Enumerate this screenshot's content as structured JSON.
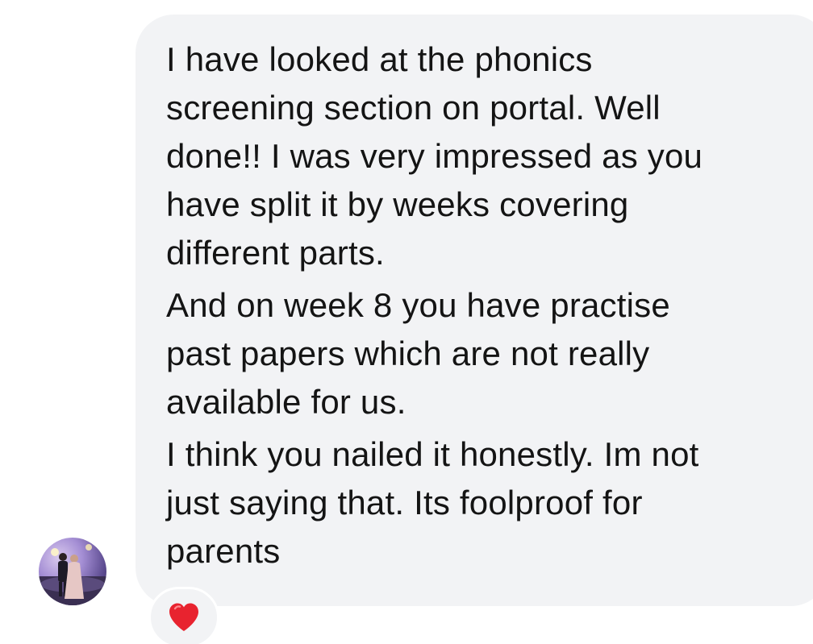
{
  "message": {
    "paragraphs": [
      "I have looked at the phonics\nscreening section on portal. Well\ndone!! I was very impressed as you\nhave split it by weeks covering\ndifferent parts.",
      "And on week 8 you have practise\npast papers which are not really\navailable for us.",
      "I think you nailed it honestly. Im not\njust saying that. Its foolproof for\nparents"
    ],
    "bubble_color": "#f2f3f5",
    "text_color": "#141414"
  },
  "avatar": {
    "icon": "profile-photo-avatar"
  },
  "reaction": {
    "icon": "red-heart-icon",
    "color": "#e8232f"
  }
}
